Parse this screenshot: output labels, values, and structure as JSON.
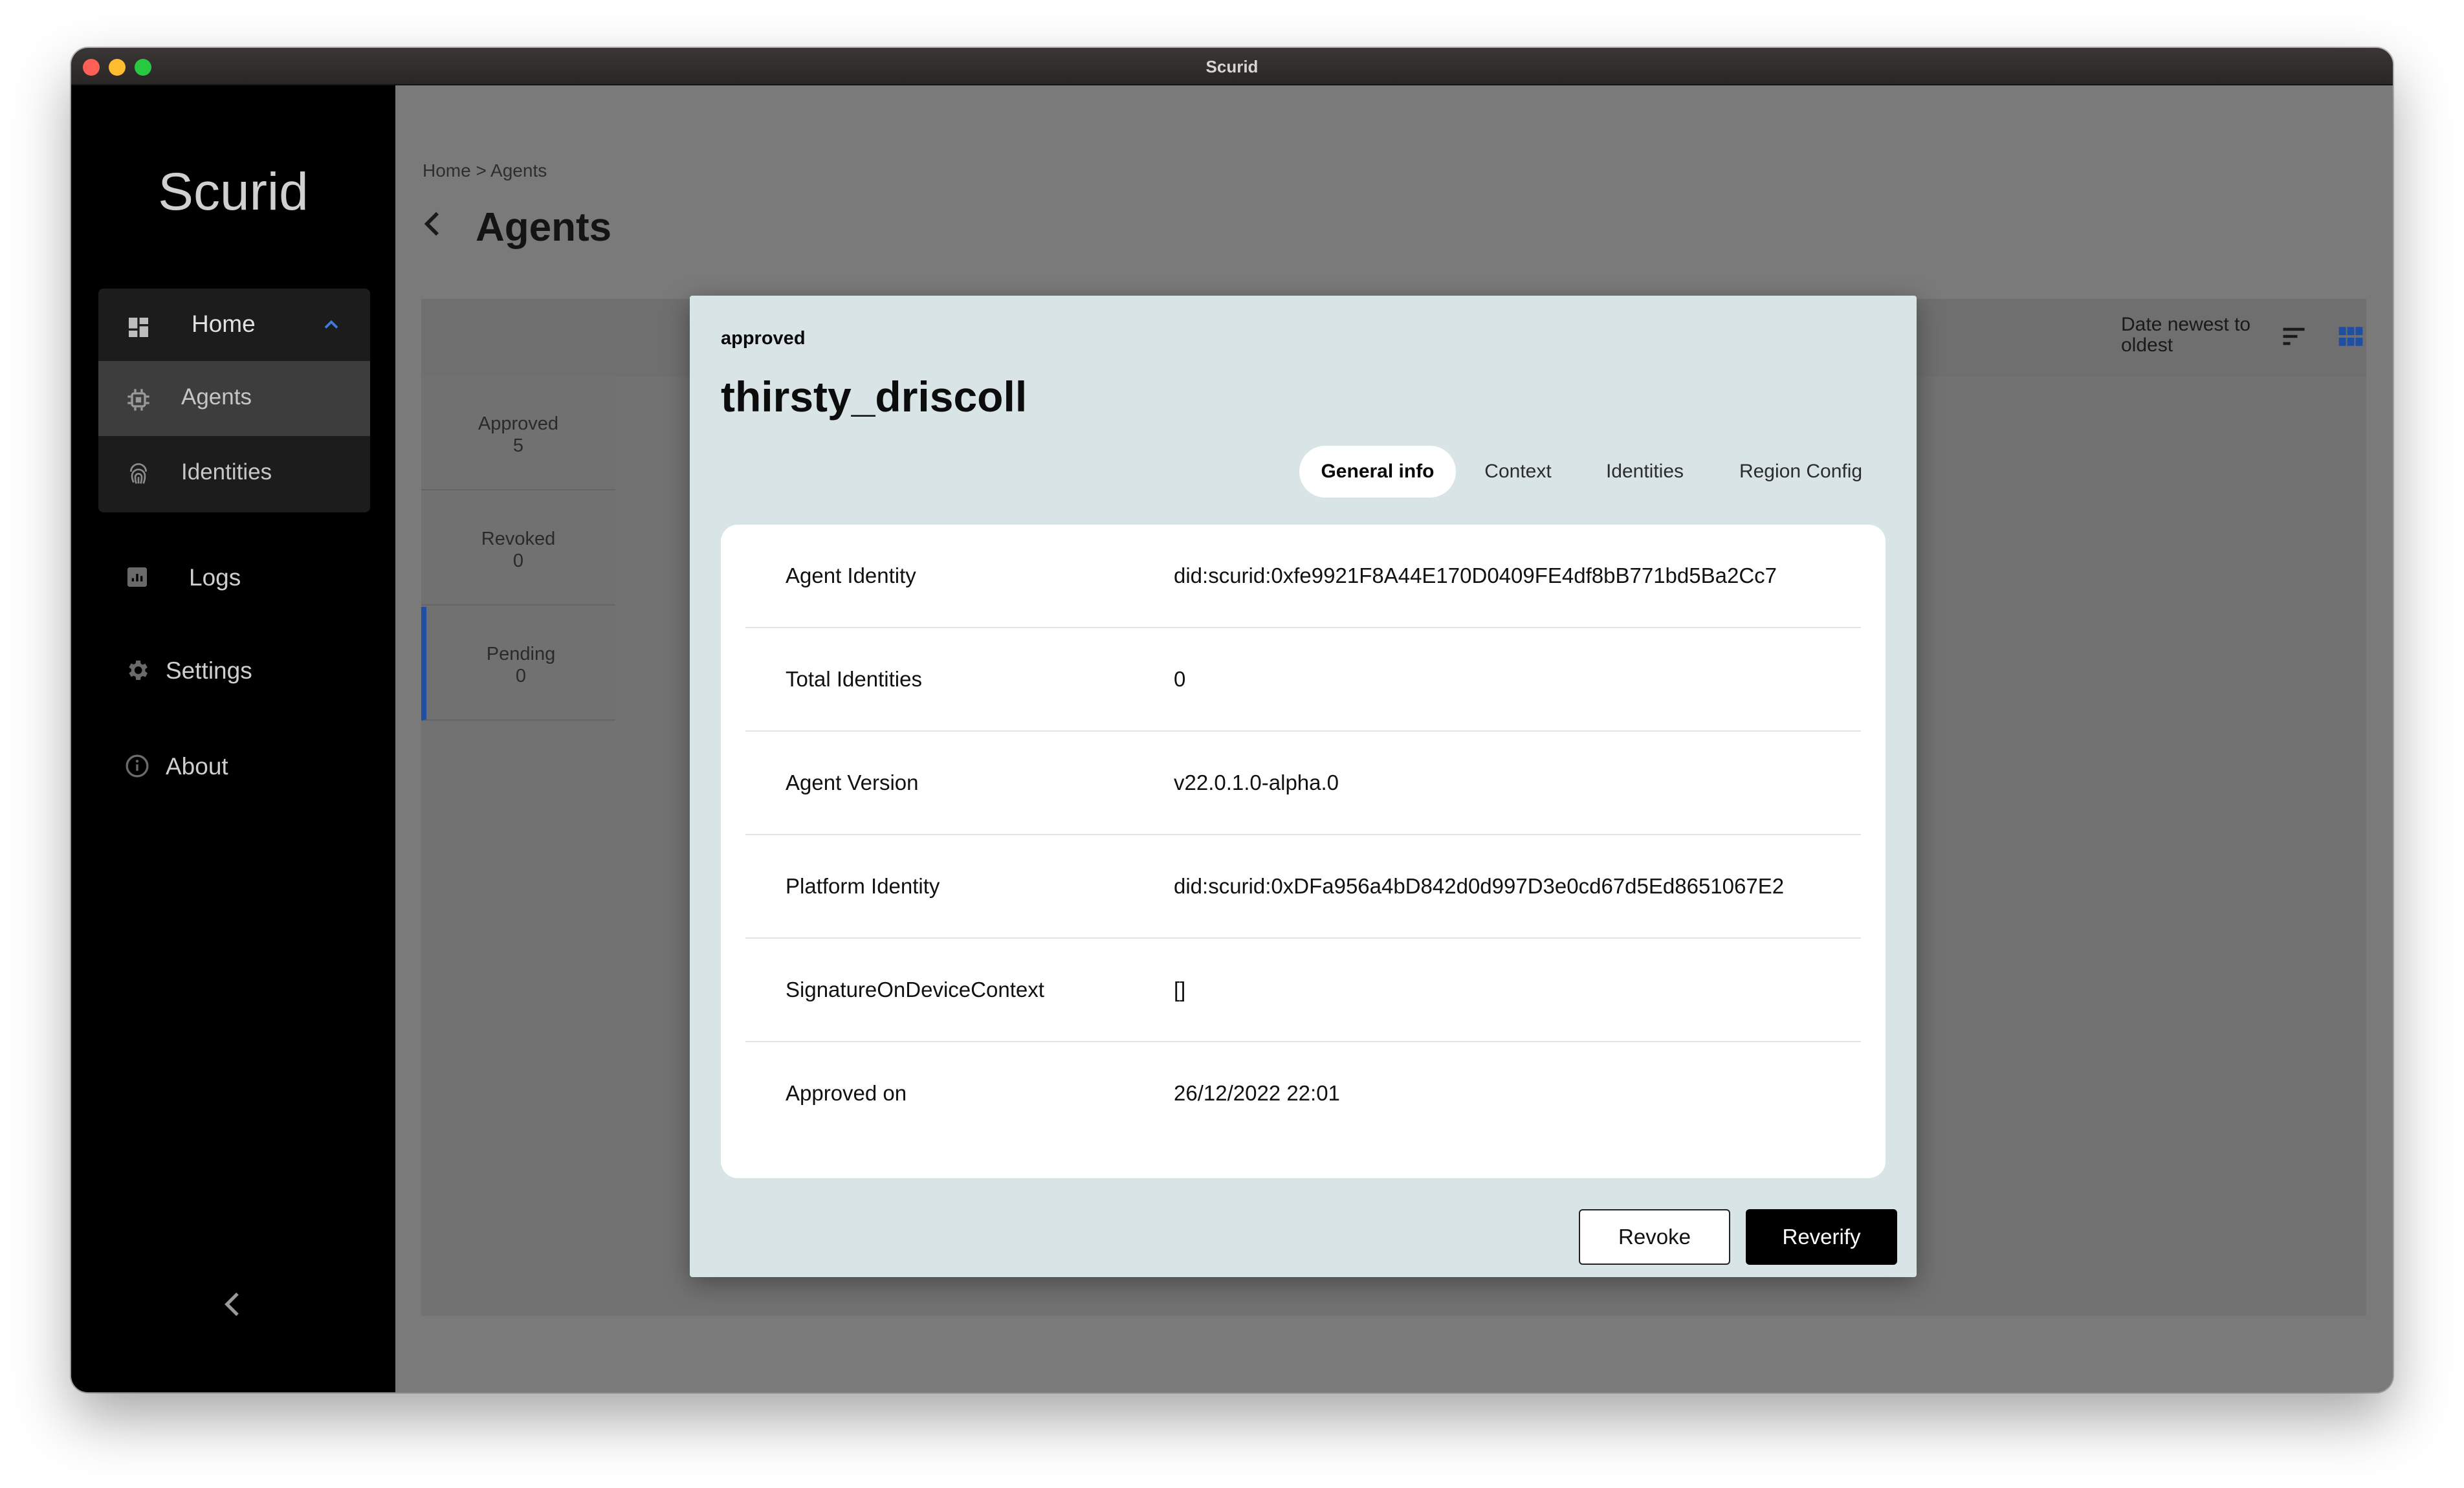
{
  "window": {
    "title": "Scurid"
  },
  "sidebar": {
    "brand": "Scurid",
    "home": {
      "label": "Home",
      "icon": "dashboard-icon"
    },
    "sub_items": [
      {
        "label": "Agents",
        "icon": "chip-icon",
        "active": true
      },
      {
        "label": "Identities",
        "icon": "fingerprint-icon",
        "active": false
      }
    ],
    "items": [
      {
        "label": "Logs",
        "icon": "chart-icon"
      },
      {
        "label": "Settings",
        "icon": "gear-icon"
      },
      {
        "label": "About",
        "icon": "info-icon"
      }
    ]
  },
  "header": {
    "breadcrumb": "Home > Agents",
    "title": "Agents"
  },
  "filters": [
    {
      "label": "Approved",
      "count": "5"
    },
    {
      "label": "Revoked",
      "count": "0"
    },
    {
      "label": "Pending",
      "count": "0",
      "active": true
    }
  ],
  "toolbar": {
    "sort_label": "Date newest to oldest"
  },
  "modal": {
    "status": "approved",
    "name": "thirsty_driscoll",
    "tabs": [
      "General info",
      "Context",
      "Identities",
      "Region Config"
    ],
    "active_tab": "General info",
    "rows": [
      {
        "key": "Agent Identity",
        "value": "did:scurid:0xfe9921F8A44E170D0409FE4df8bB771bd5Ba2Cc7"
      },
      {
        "key": "Total Identities",
        "value": "0"
      },
      {
        "key": "Agent Version",
        "value": "v22.0.1.0-alpha.0"
      },
      {
        "key": "Platform Identity",
        "value": "did:scurid:0xDFa956a4bD842d0d997D3e0cd67d5Ed8651067E2"
      },
      {
        "key": "SignatureOnDeviceContext",
        "value": "[]"
      },
      {
        "key": "Approved on",
        "value": "26/12/2022 22:01"
      }
    ],
    "revoke_label": "Revoke",
    "reverify_label": "Reverify"
  },
  "colors": {
    "accent": "#1f4fa3",
    "overlay": "#7a7a7a",
    "modal_bg": "#d9e4e6",
    "sidebar_bg": "#000000"
  }
}
